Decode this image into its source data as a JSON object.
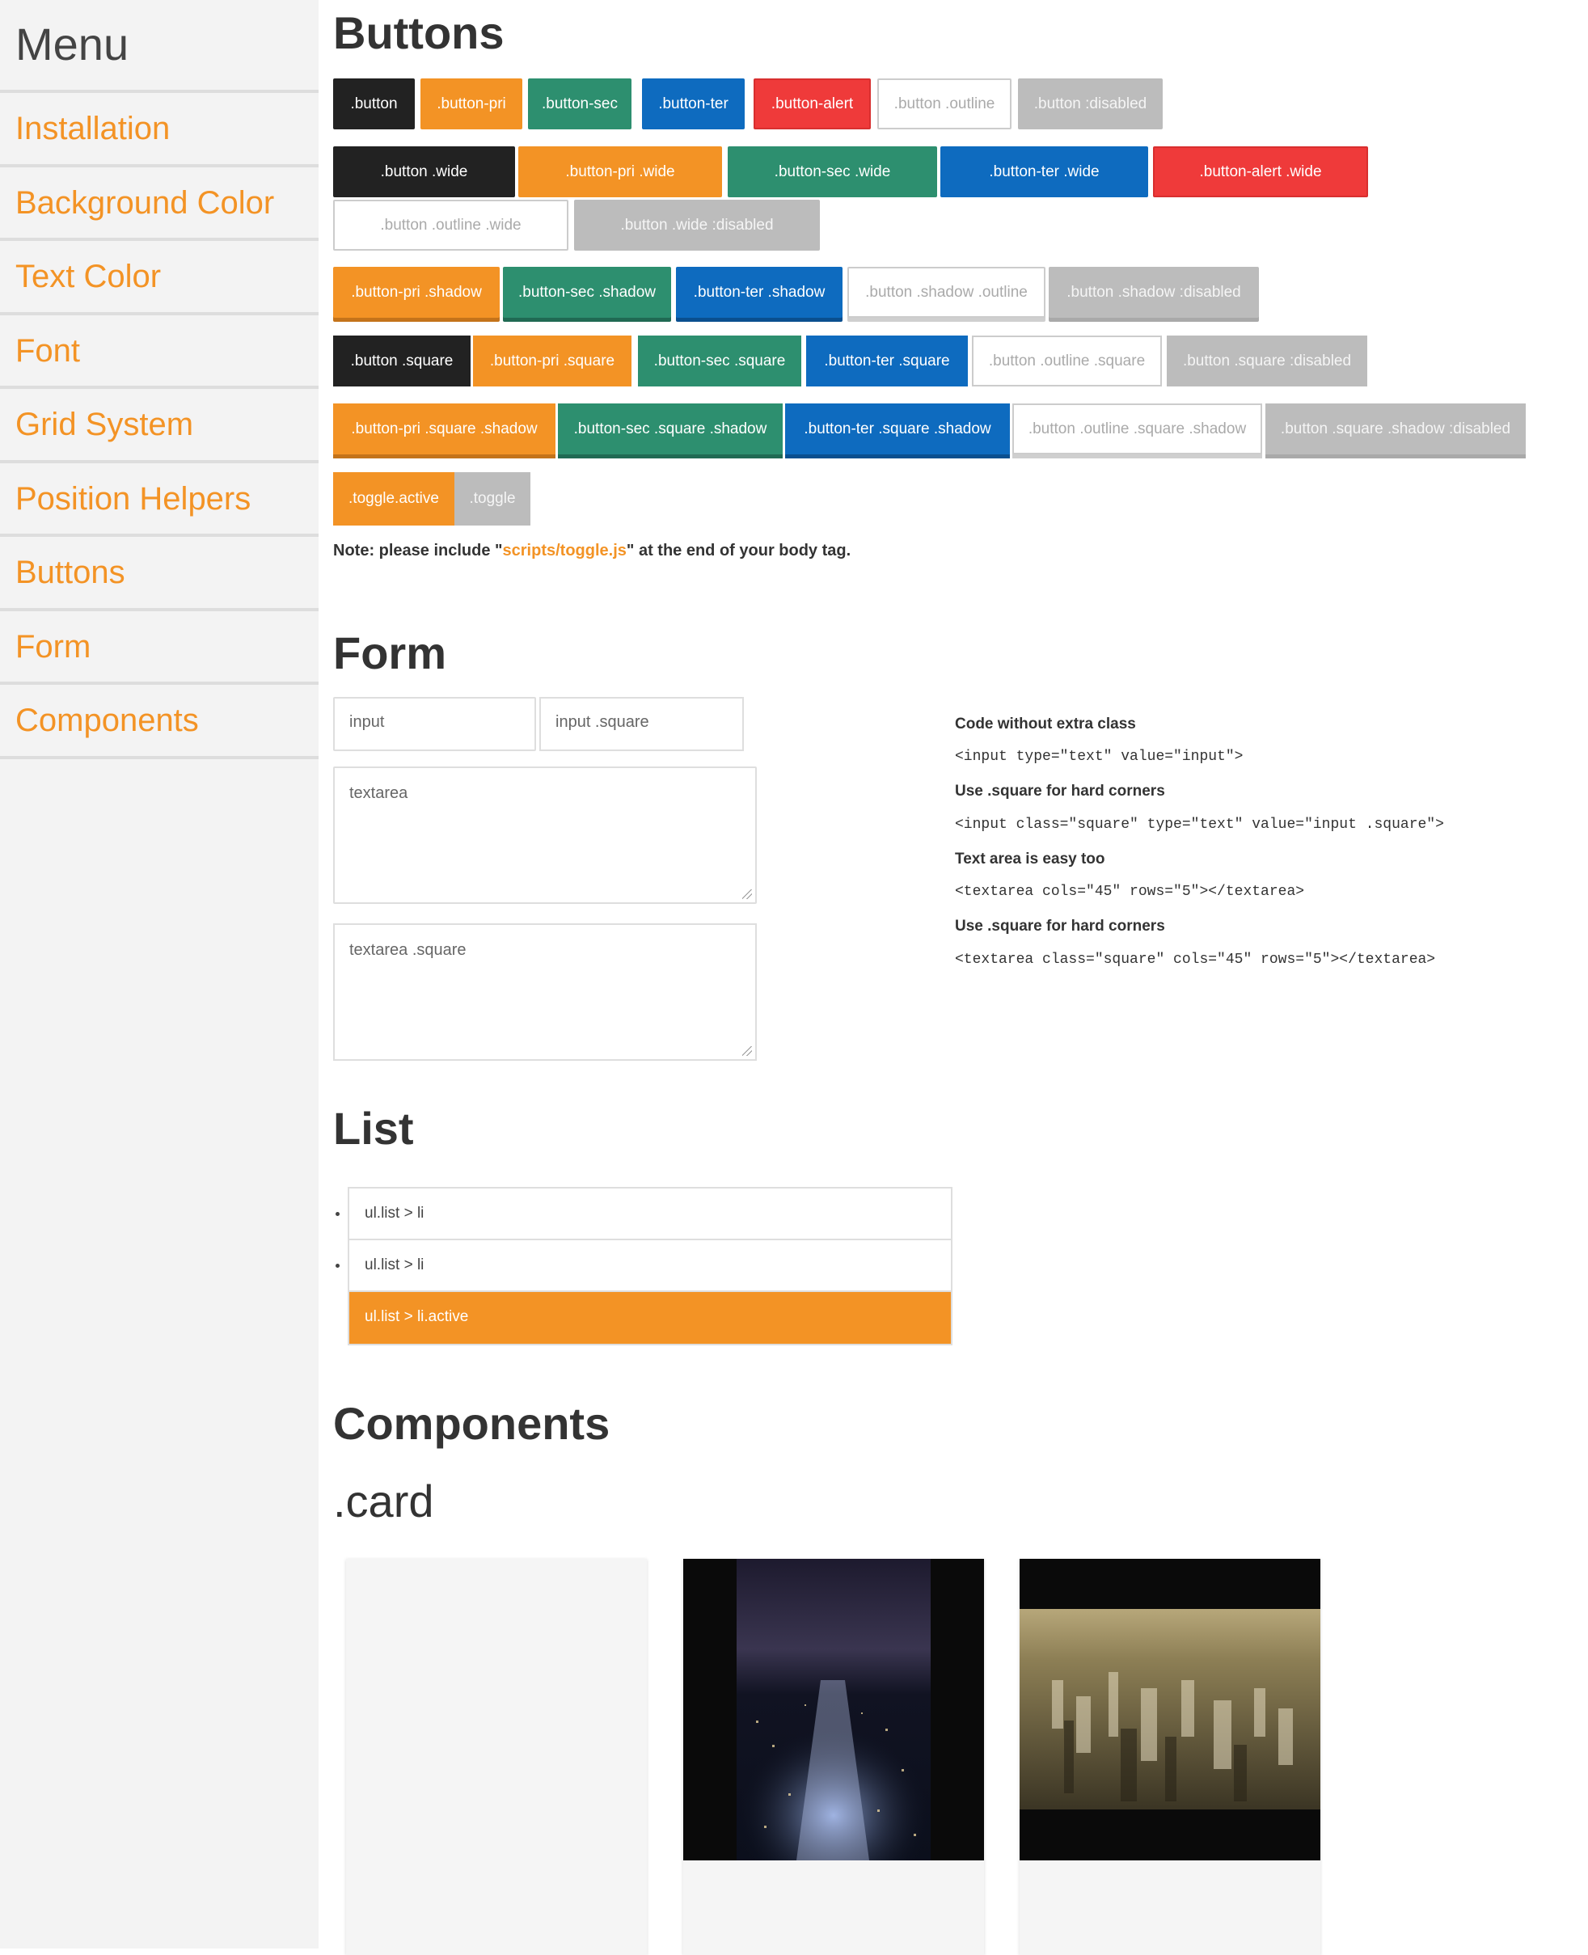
{
  "sidebar": {
    "title": "Menu",
    "items": [
      {
        "label": "Installation"
      },
      {
        "label": "Background Color"
      },
      {
        "label": "Text Color"
      },
      {
        "label": "Font"
      },
      {
        "label": "Grid System"
      },
      {
        "label": "Position Helpers"
      },
      {
        "label": "Buttons"
      },
      {
        "label": "Form"
      },
      {
        "label": "Components"
      }
    ]
  },
  "buttons": {
    "heading": "Buttons",
    "row1": [
      ".button",
      ".button-pri",
      ".button-sec",
      ".button-ter",
      ".button-alert",
      ".button .outline",
      ".button :disabled"
    ],
    "row2": [
      ".button .wide",
      ".button-pri .wide",
      ".button-sec .wide",
      ".button-ter .wide",
      ".button-alert .wide"
    ],
    "row3": [
      ".button .outline .wide",
      ".button .wide :disabled"
    ],
    "row4": [
      ".button-pri .shadow",
      ".button-sec .shadow",
      ".button-ter .shadow",
      ".button .shadow .outline",
      ".button .shadow :disabled"
    ],
    "row5": [
      ".button .square",
      ".button-pri .square",
      ".button-sec .square",
      ".button-ter .square",
      ".button .outline .square",
      ".button .square :disabled"
    ],
    "row6": [
      ".button-pri .square .shadow",
      ".button-sec .square .shadow",
      ".button-ter .square .shadow",
      ".button .outline .square .shadow",
      ".button .square .shadow :disabled"
    ],
    "toggles": [
      ".toggle.active",
      ".toggle"
    ],
    "note_prefix": "Note: please include \"",
    "note_path": "scripts/toggle.js",
    "note_suffix": "\" at the end of your body tag."
  },
  "form": {
    "heading": "Form",
    "input_value": "input",
    "input_square_value": "input .square",
    "textarea_value": "textarea",
    "textarea_square_value": "textarea .square",
    "code": [
      {
        "title": "Code without extra class",
        "code": "<input type=\"text\" value=\"input\">"
      },
      {
        "title": "Use .square for hard corners",
        "code": "<input class=\"square\" type=\"text\" value=\"input .square\">"
      },
      {
        "title": "Text area is easy too",
        "code": "<textarea cols=\"45\" rows=\"5\"></textarea>"
      },
      {
        "title": "Use .square for hard corners",
        "code": "<textarea class=\"square\" cols=\"45\" rows=\"5\"></textarea>"
      }
    ]
  },
  "list": {
    "heading": "List",
    "items": [
      "ul.list > li",
      "ul.list > li",
      "ul.list > li.active"
    ]
  },
  "components": {
    "heading": "Components",
    "card_heading": ".card"
  },
  "colors": {
    "accent": "#f39325",
    "sec": "#2d8f6f",
    "ter": "#0e6bbf",
    "alert": "#ef3a3a",
    "dark": "#222222",
    "disabled": "#bcbcbc",
    "sidebar_bg": "#f3f3f3"
  }
}
